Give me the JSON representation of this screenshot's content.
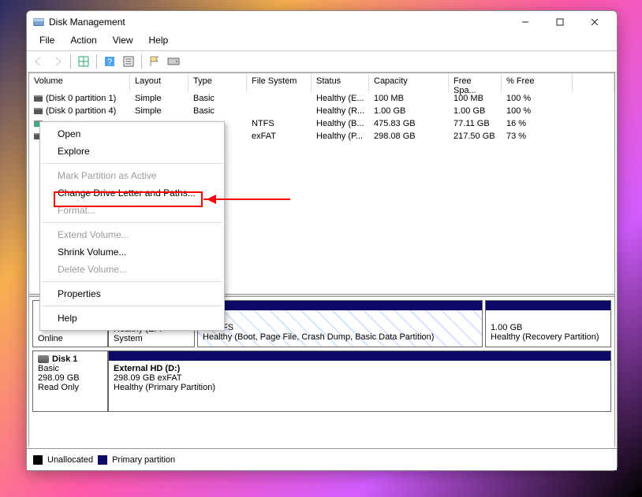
{
  "title": "Disk Management",
  "menu": {
    "file": "File",
    "action": "Action",
    "view": "View",
    "help": "Help"
  },
  "headers": [
    "Volume",
    "Layout",
    "Type",
    "File System",
    "Status",
    "Capacity",
    "Free Spa...",
    "% Free"
  ],
  "rows": [
    {
      "vol": "(Disk 0 partition 1)",
      "layout": "Simple",
      "type": "Basic",
      "fs": "",
      "status": "Healthy (E...",
      "cap": "100 MB",
      "free": "100 MB",
      "pct": "100 %"
    },
    {
      "vol": "(Disk 0 partition 4)",
      "layout": "Simple",
      "type": "Basic",
      "fs": "",
      "status": "Healthy (R...",
      "cap": "1.00 GB",
      "free": "1.00 GB",
      "pct": "100 %"
    },
    {
      "vol": "",
      "layout": "",
      "type": "",
      "fs": "NTFS",
      "status": "Healthy (B...",
      "cap": "475.83 GB",
      "free": "77.11 GB",
      "pct": "16 %"
    },
    {
      "vol": "",
      "layout": "",
      "type": "",
      "fs": "exFAT",
      "status": "Healthy (P...",
      "cap": "298.08 GB",
      "free": "217.50 GB",
      "pct": "73 %"
    }
  ],
  "context": {
    "open": "Open",
    "explore": "Explore",
    "mark": "Mark Partition as Active",
    "change": "Change Drive Letter and Paths...",
    "format": "Format...",
    "extend": "Extend Volume...",
    "shrink": "Shrink Volume...",
    "delete": "Delete Volume...",
    "properties": "Properties",
    "help": "Help"
  },
  "disk0": {
    "title": "",
    "status": "Online",
    "p1_letter": ")",
    "p1_size": "B NTFS",
    "p1_status": "Healthy (Boot, Page File, Crash Dump, Basic Data Partition)",
    "efi_status": "Healthy (EFI System",
    "p2_size": "1.00 GB",
    "p2_status": "Healthy (Recovery Partition)"
  },
  "disk1": {
    "name": "Disk 1",
    "type": "Basic",
    "size": "298.09 GB",
    "state": "Read Only",
    "p1_name": "External HD  (D:)",
    "p1_size": "298.09 GB exFAT",
    "p1_status": "Healthy (Primary Partition)"
  },
  "legend": {
    "unalloc": "Unallocated",
    "primary": "Primary partition"
  }
}
